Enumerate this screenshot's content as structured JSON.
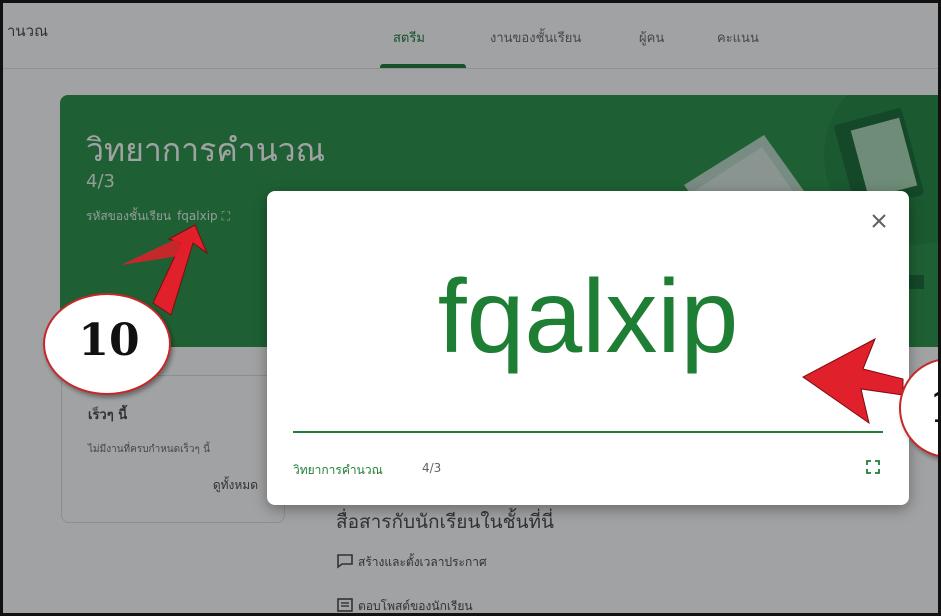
{
  "header": {
    "app_title": "านวณ",
    "tabs": [
      {
        "label": "สตรีม",
        "active": true
      },
      {
        "label": "งานของชั้นเรียน",
        "active": false
      },
      {
        "label": "ผู้คน",
        "active": false
      },
      {
        "label": "คะแนน",
        "active": false
      }
    ]
  },
  "banner": {
    "class_name": "วิทยาการคำนวณ",
    "section": "4/3",
    "code_label": "รหัสของชั้นเรียน",
    "code": "fqalxip"
  },
  "upcoming": {
    "title": "เร็วๆ นี้",
    "empty_text": "ไม่มีงานที่ครบกำหนดเร็วๆ นี้",
    "view_all": "ดูทั้งหมด"
  },
  "stream": {
    "title": "สื่อสารกับนักเรียนในชั้นที่นี่",
    "items": [
      {
        "label": "สร้างและตั้งเวลาประกาศ",
        "icon": "announcement-icon"
      },
      {
        "label": "ตอบโพสต์ของนักเรียน",
        "icon": "reply-icon"
      }
    ]
  },
  "dialog": {
    "code": "fqalxip",
    "class_name": "วิทยาการคำนวณ",
    "section": "4/3"
  },
  "annotations": {
    "callout_1": "10",
    "callout_2": "1"
  },
  "colors": {
    "accent_green": "#1e7e34",
    "banner_green": "#1e8e3e",
    "annotation_red": "#e0202a"
  }
}
